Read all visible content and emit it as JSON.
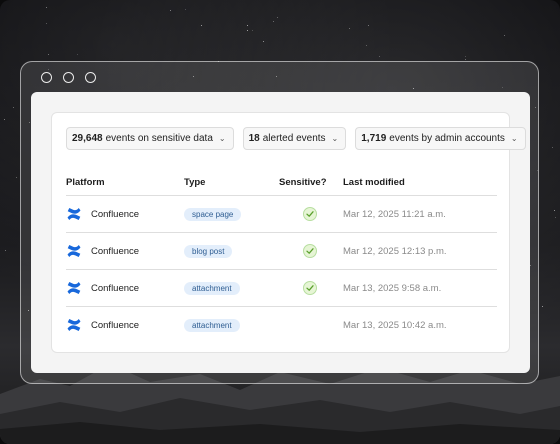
{
  "filters": [
    {
      "count": "29,648",
      "label": "events on sensitive data"
    },
    {
      "count": "18",
      "label": "alerted events"
    },
    {
      "count": "1,719",
      "label": "events by admin accounts"
    }
  ],
  "table": {
    "headers": [
      "Platform",
      "Type",
      "Sensitive?",
      "Last modified"
    ],
    "rows": [
      {
        "platform": "Confluence",
        "type": "space page",
        "sensitive": true,
        "modified": "Mar 12, 2025 11:21 a.m."
      },
      {
        "platform": "Confluence",
        "type": "blog post",
        "sensitive": true,
        "modified": "Mar 12, 2025 12:13 p.m."
      },
      {
        "platform": "Confluence",
        "type": "attachment",
        "sensitive": true,
        "modified": "Mar 13, 2025 9:58 a.m."
      },
      {
        "platform": "Confluence",
        "type": "attachment",
        "sensitive": false,
        "modified": "Mar 13, 2025 10:42 a.m."
      }
    ]
  },
  "icons": {
    "platform_logo": "confluence-logo-icon",
    "sensitive_mark": "check-icon",
    "filter_dropdown": "chevron-down-icon"
  },
  "colors": {
    "tag_bg": "#e3eefb",
    "tag_text": "#2e5d92",
    "check_bg": "#e6f5d5",
    "check_mark": "#5aa02c",
    "logo_blue": "#1868db"
  }
}
